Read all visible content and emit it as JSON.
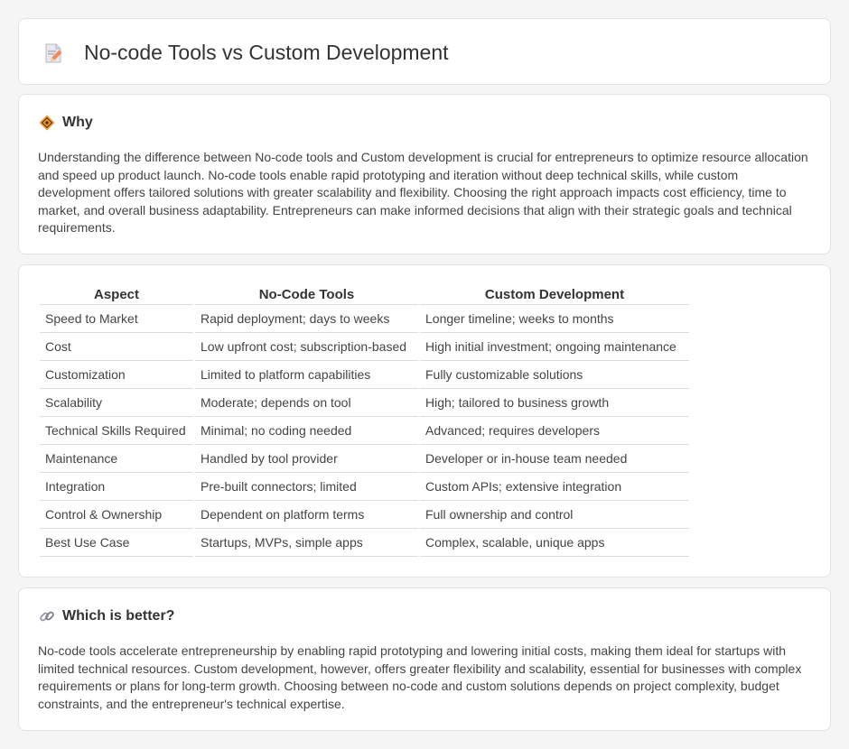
{
  "header": {
    "title": "No-code Tools vs Custom Development",
    "icon": "document-pencil-icon"
  },
  "why": {
    "icon": "diamond-sign-icon",
    "heading": "Why",
    "text": "Understanding the difference between No-code tools and Custom development is crucial for entrepreneurs to optimize resource allocation and speed up product launch. No-code tools enable rapid prototyping and iteration without deep technical skills, while custom development offers tailored solutions with greater scalability and flexibility. Choosing the right approach impacts cost efficiency, time to market, and overall business adaptability. Entrepreneurs can make informed decisions that align with their strategic goals and technical requirements."
  },
  "comparison": {
    "headers": [
      "Aspect",
      "No-Code Tools",
      "Custom Development"
    ],
    "rows": [
      [
        "Speed to Market",
        "Rapid deployment; days to weeks",
        "Longer timeline; weeks to months"
      ],
      [
        "Cost",
        "Low upfront cost; subscription-based",
        "High initial investment; ongoing maintenance"
      ],
      [
        "Customization",
        "Limited to platform capabilities",
        "Fully customizable solutions"
      ],
      [
        "Scalability",
        "Moderate; depends on tool",
        "High; tailored to business growth"
      ],
      [
        "Technical Skills Required",
        "Minimal; no coding needed",
        "Advanced; requires developers"
      ],
      [
        "Maintenance",
        "Handled by tool provider",
        "Developer or in-house team needed"
      ],
      [
        "Integration",
        "Pre-built connectors; limited",
        "Custom APIs; extensive integration"
      ],
      [
        "Control & Ownership",
        "Dependent on platform terms",
        "Full ownership and control"
      ],
      [
        "Best Use Case",
        "Startups, MVPs, simple apps",
        "Complex, scalable, unique apps"
      ]
    ]
  },
  "better": {
    "icon": "link-icon",
    "heading": "Which is better?",
    "text": "No-code tools accelerate entrepreneurship by enabling rapid prototyping and lowering initial costs, making them ideal for startups with limited technical resources. Custom development, however, offers greater flexibility and scalability, essential for businesses with complex requirements or plans for long-term growth. Choosing between no-code and custom solutions depends on project complexity, budget constraints, and the entrepreneur's technical expertise."
  },
  "colors": {
    "background": "#f5f5f5",
    "card": "#ffffff",
    "border": "#e3e3e3",
    "icon_accent": "#f0932b"
  }
}
